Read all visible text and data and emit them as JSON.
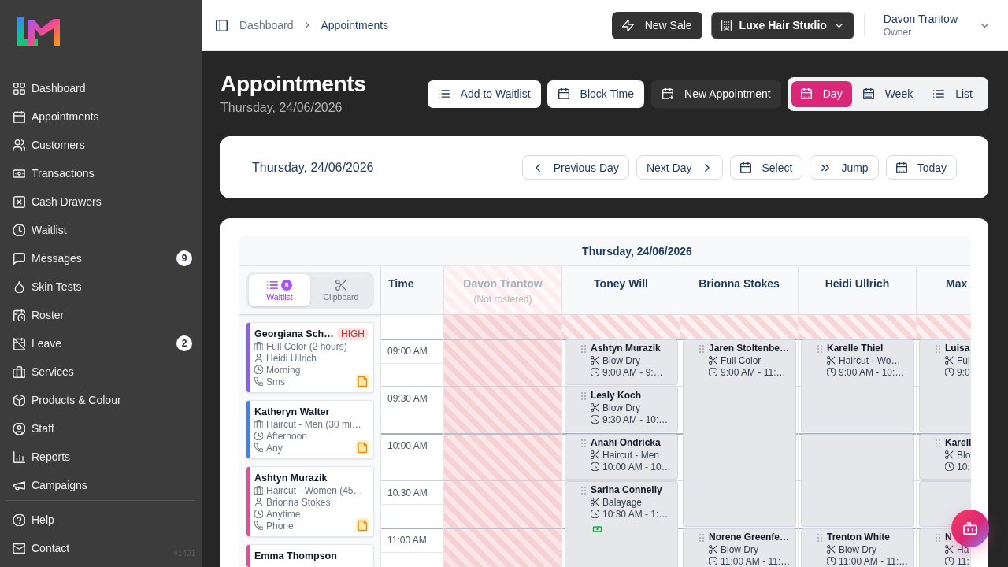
{
  "sidebar": {
    "items": [
      {
        "label": "Dashboard"
      },
      {
        "label": "Appointments"
      },
      {
        "label": "Customers"
      },
      {
        "label": "Transactions"
      },
      {
        "label": "Cash Drawers"
      },
      {
        "label": "Waitlist"
      },
      {
        "label": "Messages",
        "badge": "9"
      },
      {
        "label": "Skin Tests"
      },
      {
        "label": "Roster"
      },
      {
        "label": "Leave",
        "badge": "2"
      },
      {
        "label": "Services"
      },
      {
        "label": "Products & Colour"
      },
      {
        "label": "Staff"
      },
      {
        "label": "Reports"
      },
      {
        "label": "Campaigns"
      }
    ],
    "footer_items": [
      {
        "label": "Help"
      },
      {
        "label": "Contact"
      }
    ],
    "version": "v1401"
  },
  "top_bar": {
    "breadcrumb": [
      {
        "label": "Dashboard",
        "current": false
      },
      {
        "label": "Appointments",
        "current": true
      }
    ],
    "new_sale": "New Sale",
    "location": "Luxe Hair Studio",
    "user": {
      "name": "Davon Trantow",
      "role": "Owner"
    }
  },
  "page_header": {
    "title": "Appointments",
    "subtitle": "Thursday, 24/06/2026",
    "actions": [
      {
        "label": "Add to Waitlist",
        "kind": "light"
      },
      {
        "label": "Block Time",
        "kind": "light"
      },
      {
        "label": "New Appointment",
        "kind": "dark"
      }
    ],
    "views": [
      {
        "label": "Day",
        "selected": true
      },
      {
        "label": "Week",
        "selected": false
      },
      {
        "label": "List",
        "selected": false
      }
    ]
  },
  "date_bar": {
    "date": "Thursday, 24/06/2026",
    "buttons": [
      "Previous Day",
      "Next Day",
      "Select",
      "Jump",
      "Today"
    ]
  },
  "calendar": {
    "date": "Thursday, 24/06/2026",
    "panel_tabs": [
      {
        "label": "Waitlist",
        "badge": "5",
        "selected": true
      },
      {
        "label": "Clipboard",
        "selected": false
      }
    ],
    "waitlist": [
      {
        "name": "Georgiana Sch…",
        "priority": "HIGH",
        "color": "#8b5cf6",
        "service": "Full Color (2 hours)",
        "staff": "Heidi Ullrich",
        "time_preference": "Morning",
        "contact": "Sms",
        "note": true
      },
      {
        "name": "Katheryn Walter",
        "color": "#3b82f6",
        "service": "Haircut - Men (30 mi…",
        "time_preference": "Afternoon",
        "contact": "Any",
        "note": true
      },
      {
        "name": "Ashtyn Murazik",
        "color": "#ec4899",
        "service": "Haircut - Women (45…",
        "staff": "Brionna Stokes",
        "time_preference": "Anytime",
        "contact": "Phone",
        "note": true
      },
      {
        "name": "Emma Thompson",
        "color": "#ec4899"
      }
    ],
    "time_heading": "Time",
    "times": [
      "09:00 AM",
      "09:30 AM",
      "10:00 AM",
      "10:30 AM",
      "11:00 AM"
    ],
    "staff": [
      {
        "name": "Davon Trantow",
        "status": "(Not rostered)",
        "rostered": false
      },
      {
        "name": "Toney Will",
        "rostered": true,
        "slots": [
          {
            "kind": "booking",
            "client": "Ashtyn Murazik",
            "service": "Blow Dry",
            "time": "9:00 AM - 9:…"
          },
          {
            "kind": "booking",
            "client": "Lesly Koch",
            "service": "Blow Dry",
            "time": "9:30 AM - 10:…"
          },
          {
            "kind": "booking",
            "client": "Anahi Ondricka",
            "service": "Haircut - Men",
            "time": "10:00 AM - 10…"
          },
          {
            "kind": "booking",
            "client": "Sarina Connelly",
            "service": "Balayage",
            "time": "10:30 AM - 1:…",
            "paid": true
          },
          {
            "kind": "continued"
          }
        ]
      },
      {
        "name": "Brionna Stokes",
        "rostered": true,
        "slots": [
          {
            "kind": "booking",
            "client": "Jaren Stoltenbe…",
            "service": "Full Color",
            "time": "9:00 AM - 11:…"
          },
          {
            "kind": "continued"
          },
          {
            "kind": "continued"
          },
          {
            "kind": "continued"
          },
          {
            "kind": "booking",
            "client": "Norene Greenfe…",
            "service": "Blow Dry",
            "time": "11:00 AM - 11:…"
          }
        ]
      },
      {
        "name": "Heidi Ullrich",
        "rostered": true,
        "slots": [
          {
            "kind": "booking",
            "client": "Karelle Thiel",
            "service": "Haircut - Wo…",
            "time": "9:00 AM - 10:…"
          },
          {
            "kind": "continued"
          },
          {
            "kind": "blank"
          },
          {
            "kind": "continued"
          },
          {
            "kind": "booking",
            "client": "Trenton White",
            "service": "Blow Dry",
            "time": "11:00 AM - 11:…"
          }
        ]
      },
      {
        "name": "Max",
        "rostered": true,
        "slots": [
          {
            "kind": "booking",
            "client": "Luisa",
            "service": "Ful",
            "time": "9:0"
          },
          {
            "kind": "continued"
          },
          {
            "kind": "booking",
            "client": "Karell",
            "service": "Blo",
            "time": "10:"
          },
          {
            "kind": "blank"
          },
          {
            "kind": "booking",
            "client": "N",
            "service": "Ha",
            "time": "11:"
          }
        ]
      }
    ]
  }
}
